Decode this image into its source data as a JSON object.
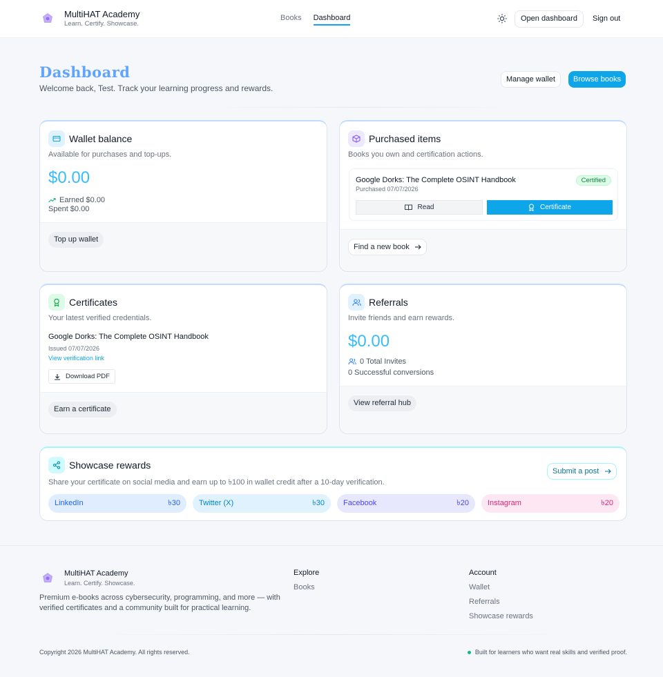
{
  "header": {
    "brand_title": "MultiHAT Academy",
    "brand_tagline": "Learn. Certify. Showcase.",
    "nav": [
      {
        "label": "Books"
      },
      {
        "label": "Dashboard"
      }
    ],
    "open_dashboard": "Open dashboard",
    "sign_out": "Sign out"
  },
  "page": {
    "title": "Dashboard",
    "subtitle": "Welcome back, Test. Track your learning progress and rewards.",
    "manage_wallet": "Manage wallet",
    "browse_books": "Browse books"
  },
  "wallet": {
    "title": "Wallet balance",
    "desc": "Available for purchases and top-ups.",
    "amount": "$0.00",
    "earned": "Earned $0.00",
    "spent": "Spent $0.00",
    "action": "Top up wallet"
  },
  "purchased": {
    "title": "Purchased items",
    "desc": "Books you own and certification actions.",
    "item_title": "Google Dorks: The Complete OSINT Handbook",
    "item_date": "Purchased 07/07/2026",
    "badge": "Certified",
    "read": "Read",
    "certificate": "Certificate",
    "action": "Find a new book"
  },
  "certificates": {
    "title": "Certificates",
    "desc": "Your latest verified credentials.",
    "item_title": "Google Dorks: The Complete OSINT Handbook",
    "issued": "Issued 07/07/2026",
    "verify_link": "View verification link",
    "download": "Download PDF",
    "action": "Earn a certificate"
  },
  "referrals": {
    "title": "Referrals",
    "desc": "Invite friends and earn rewards.",
    "amount": "$0.00",
    "invites": "0 Total Invites",
    "conversions": "0 Successful conversions",
    "action": "View referral hub"
  },
  "showcase": {
    "title": "Showcase rewards",
    "desc": "Share your certificate on social media and earn up to ৳100 in wallet credit after a 10-day verification.",
    "submit": "Submit a post",
    "platforms": [
      {
        "name": "LinkedIn",
        "reward": "৳30"
      },
      {
        "name": "Twitter (X)",
        "reward": "৳30"
      },
      {
        "name": "Facebook",
        "reward": "৳20"
      },
      {
        "name": "Instagram",
        "reward": "৳20"
      }
    ]
  },
  "footer": {
    "brand_title": "MultiHAT Academy",
    "brand_tagline": "Learn. Certify. Showcase.",
    "about": "Premium e-books across cybersecurity, programming, and more — with verified certificates and a community built for practical learning.",
    "explore_title": "Explore",
    "explore_links": [
      "Books"
    ],
    "account_title": "Account",
    "account_links": [
      "Wallet",
      "Referrals",
      "Showcase rewards"
    ],
    "copyright": "Copyright 2026 MultiHAT Academy. All rights reserved.",
    "tagline": "Built for learners who want real skills and verified proof."
  },
  "colors": {
    "accent": "#0ea5e9",
    "amount": "#38bdf8",
    "title": "#60a5fa",
    "success": "#10b981"
  }
}
